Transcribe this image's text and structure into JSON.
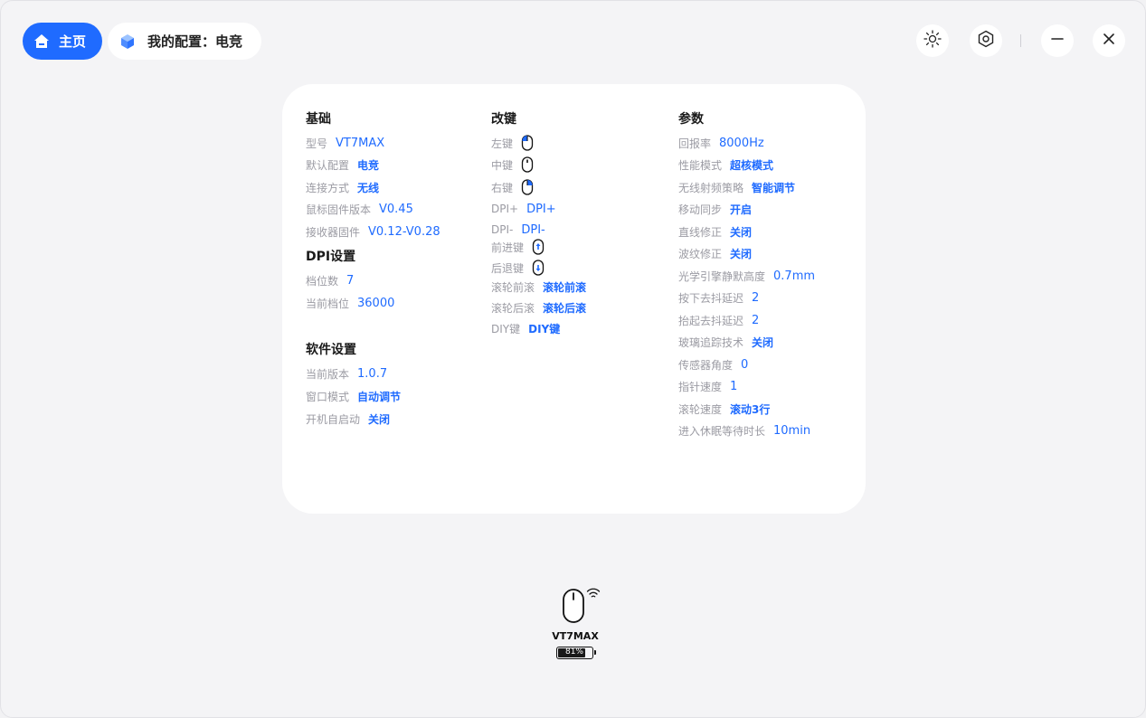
{
  "header": {
    "home_label": "主页",
    "profile_label": "我的配置：电竞"
  },
  "basic": {
    "title": "基础",
    "rows": [
      {
        "label": "型号",
        "value": "VT7MAX"
      },
      {
        "label": "默认配置",
        "value": "电竞"
      },
      {
        "label": "连接方式",
        "value": "无线"
      },
      {
        "label": "鼠标固件版本",
        "value": "V0.45"
      },
      {
        "label": "接收器固件",
        "value": "V0.12-V0.28"
      }
    ]
  },
  "dpi": {
    "title": "DPI设置",
    "rows": [
      {
        "label": "档位数",
        "value": "7"
      },
      {
        "label": "当前档位",
        "value": "36000"
      }
    ]
  },
  "software": {
    "title": "软件设置",
    "rows": [
      {
        "label": "当前版本",
        "value": "1.0.7"
      },
      {
        "label": "窗口模式",
        "value": "自动调节"
      },
      {
        "label": "开机自启动",
        "value": "关闭"
      }
    ]
  },
  "keys": {
    "title": "改键",
    "rows": [
      {
        "label": "左键",
        "icon": "mouse-left-icon"
      },
      {
        "label": "中键",
        "icon": "mouse-middle-icon"
      },
      {
        "label": "右键",
        "icon": "mouse-right-icon"
      },
      {
        "label": "DPI+",
        "value": "DPI+"
      },
      {
        "label": "DPI-",
        "value": "DPI-"
      },
      {
        "label": "前进键",
        "icon": "mouse-forward-icon"
      },
      {
        "label": "后退键",
        "icon": "mouse-back-icon"
      },
      {
        "label": "滚轮前滚",
        "value": "滚轮前滚"
      },
      {
        "label": "滚轮后滚",
        "value": "滚轮后滚"
      },
      {
        "label": "DIY键",
        "value": "DIY键"
      }
    ]
  },
  "params": {
    "title": "参数",
    "rows": [
      {
        "label": "回报率",
        "value": "8000Hz"
      },
      {
        "label": "性能模式",
        "value": "超核模式"
      },
      {
        "label": "无线射频策略",
        "value": "智能调节"
      },
      {
        "label": "移动同步",
        "value": "开启"
      },
      {
        "label": "直线修正",
        "value": "关闭"
      },
      {
        "label": "波纹修正",
        "value": "关闭"
      },
      {
        "label": "光学引擎静默高度",
        "value": "0.7mm"
      },
      {
        "label": "按下去抖延迟",
        "value": "2"
      },
      {
        "label": "抬起去抖延迟",
        "value": "2"
      },
      {
        "label": "玻璃追踪技术",
        "value": "关闭"
      },
      {
        "label": "传感器角度",
        "value": "0"
      },
      {
        "label": "指针速度",
        "value": "1"
      },
      {
        "label": "滚轮速度",
        "value": "滚动3行"
      },
      {
        "label": "进入休眠等待时长",
        "value": "10min"
      }
    ]
  },
  "device": {
    "name": "VT7MAX",
    "battery_text": "81%",
    "battery_percent": 81
  },
  "colors": {
    "accent": "#1f6bff",
    "label": "#9b9ba3"
  }
}
